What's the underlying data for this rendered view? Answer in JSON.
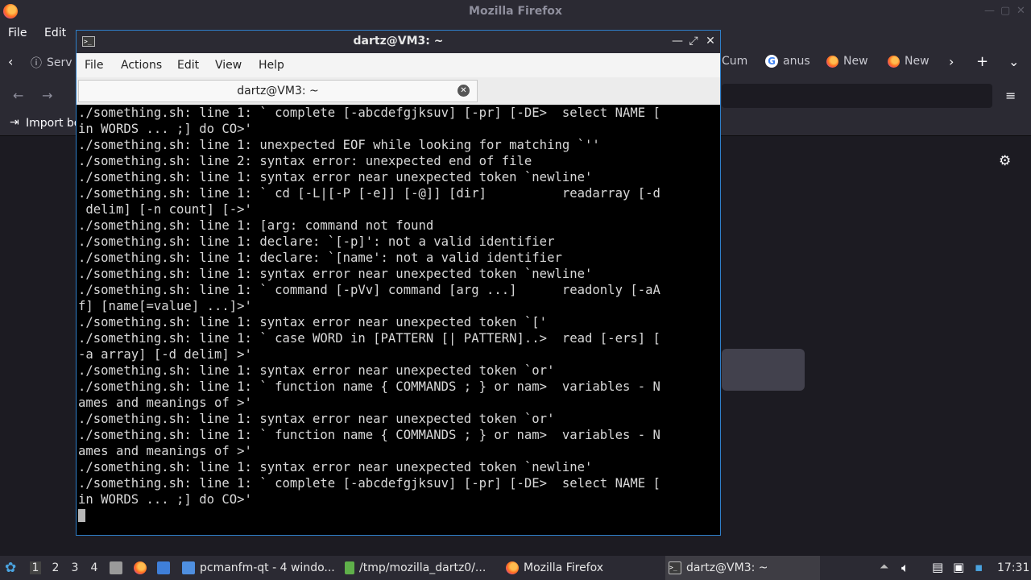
{
  "firefox": {
    "window_title": "Mozilla Firefox",
    "menu": {
      "file": "File",
      "edit": "Edit"
    },
    "tabs": [
      {
        "label": "Serv",
        "icon": "info-icon"
      },
      {
        "label": "Cum",
        "icon": "page-icon"
      },
      {
        "label": "anus",
        "icon": "google-icon"
      },
      {
        "label": "New",
        "icon": "firefox-icon"
      },
      {
        "label": "New",
        "icon": "firefox-icon"
      }
    ],
    "bookmarks": {
      "import": "Import bo"
    }
  },
  "terminal_window": {
    "title": "dartz@VM3: ~",
    "menu": {
      "file": "File",
      "actions": "Actions",
      "edit": "Edit",
      "view": "View",
      "help": "Help"
    },
    "tab_label": "dartz@VM3: ~",
    "lines": [
      "./something.sh: line 1: ` complete [-abcdefgjksuv] [-pr] [-DE>  select NAME [",
      "in WORDS ... ;] do CO>'",
      "./something.sh: line 1: unexpected EOF while looking for matching `''",
      "./something.sh: line 2: syntax error: unexpected end of file",
      "./something.sh: line 1: syntax error near unexpected token `newline'",
      "./something.sh: line 1: ` cd [-L|[-P [-e]] [-@]] [dir]          readarray [-d",
      " delim] [-n count] [->'",
      "./something.sh: line 1: [arg: command not found",
      "./something.sh: line 1: declare: `[-p]': not a valid identifier",
      "./something.sh: line 1: declare: `[name': not a valid identifier",
      "./something.sh: line 1: syntax error near unexpected token `newline'",
      "./something.sh: line 1: ` command [-pVv] command [arg ...]      readonly [-aA",
      "f] [name[=value] ...]>'",
      "./something.sh: line 1: syntax error near unexpected token `['",
      "./something.sh: line 1: ` case WORD in [PATTERN [| PATTERN]..>  read [-ers] [",
      "-a array] [-d delim] >'",
      "./something.sh: line 1: syntax error near unexpected token `or'",
      "./something.sh: line 1: ` function name { COMMANDS ; } or nam>  variables - N",
      "ames and meanings of >'",
      "./something.sh: line 1: syntax error near unexpected token `or'",
      "./something.sh: line 1: ` function name { COMMANDS ; } or nam>  variables - N",
      "ames and meanings of >'",
      "./something.sh: line 1: syntax error near unexpected token `newline'",
      "./something.sh: line 1: ` complete [-abcdefgjksuv] [-pr] [-DE>  select NAME [",
      "in WORDS ... ;] do CO>'"
    ]
  },
  "taskbar": {
    "workspaces": [
      "1",
      "2",
      "3",
      "4"
    ],
    "active_workspace": "1",
    "tasks": [
      {
        "label": "pcmanfm-qt - 4 windo...",
        "icon": "folder-icon"
      },
      {
        "label": "/tmp/mozilla_dartz0/...",
        "icon": "file-icon"
      },
      {
        "label": "Mozilla Firefox",
        "icon": "firefox-icon"
      },
      {
        "label": "dartz@VM3: ~",
        "icon": "terminal-icon"
      }
    ],
    "clock": "17:31"
  },
  "colors": {
    "accent": "#2f7fc9",
    "terminal_bg": "#000000",
    "terminal_fg": "#d8d8d8"
  }
}
